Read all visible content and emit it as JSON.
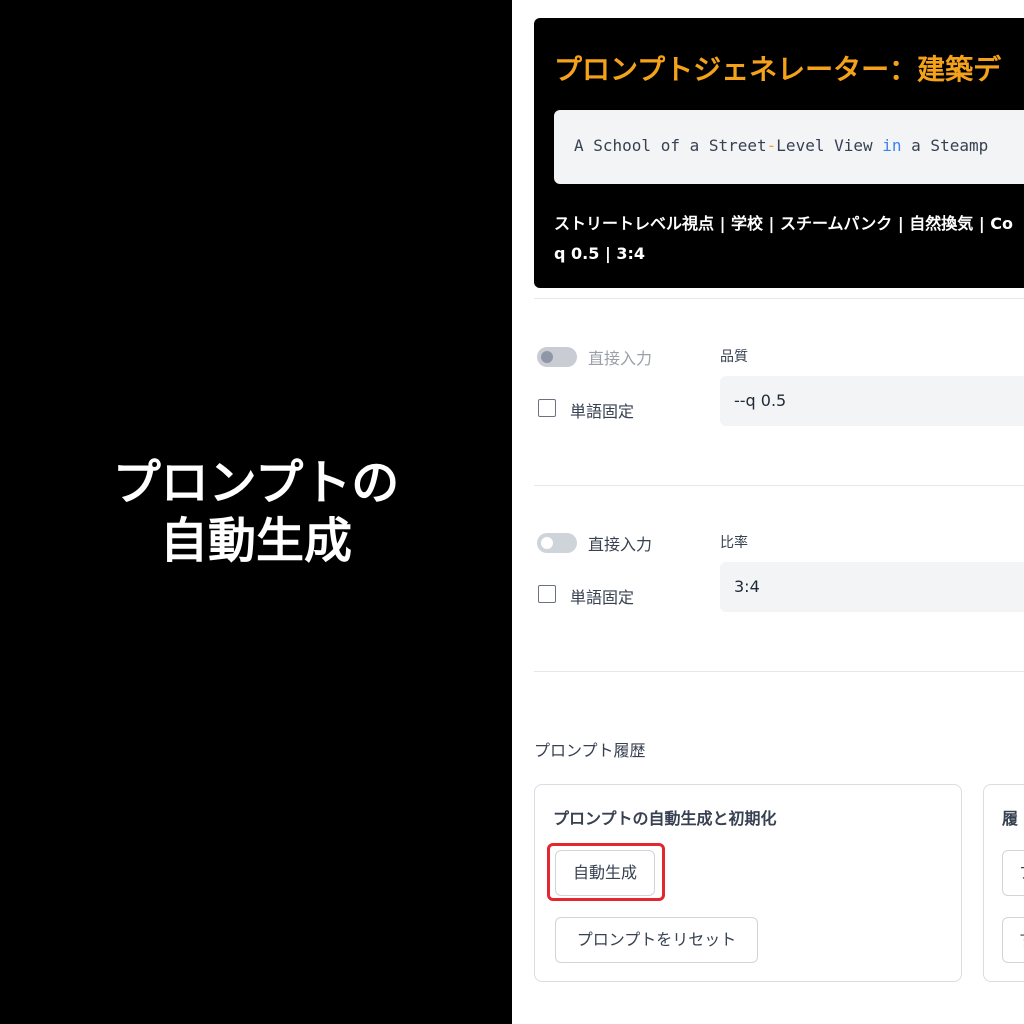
{
  "headline": {
    "line1": "プロンプトの",
    "line2": "自動生成"
  },
  "generator": {
    "title": "プロンプトジェネレーター：建築デ",
    "code": {
      "part1": "A School of a Street",
      "dash": "-",
      "part2": "Level View ",
      "kw": "in",
      "part3": " a Steamp"
    },
    "tags_line1": "ストリートレベル視点 | 学校 | スチームパンク | 自然換気 | Co",
    "tags_line2": "q 0.5 | 3:4"
  },
  "quality_section": {
    "toggle_label": "直接入力",
    "checkbox_label": "単語固定",
    "field_label": "品質",
    "field_value": "--q 0.5"
  },
  "ratio_section": {
    "toggle_label": "直接入力",
    "checkbox_label": "単語固定",
    "field_label": "比率",
    "field_value": "3:4"
  },
  "history": {
    "title": "プロンプト履歴",
    "card1": {
      "title": "プロンプトの自動生成と初期化",
      "auto_button": "自動生成",
      "reset_button": "プロンプトをリセット"
    },
    "card2": {
      "title": "履",
      "button1": "プ",
      "button2": "す"
    }
  },
  "colors": {
    "accent": "#f5a21b",
    "highlight": "#e3262f",
    "keyword": "#3b82f6"
  }
}
